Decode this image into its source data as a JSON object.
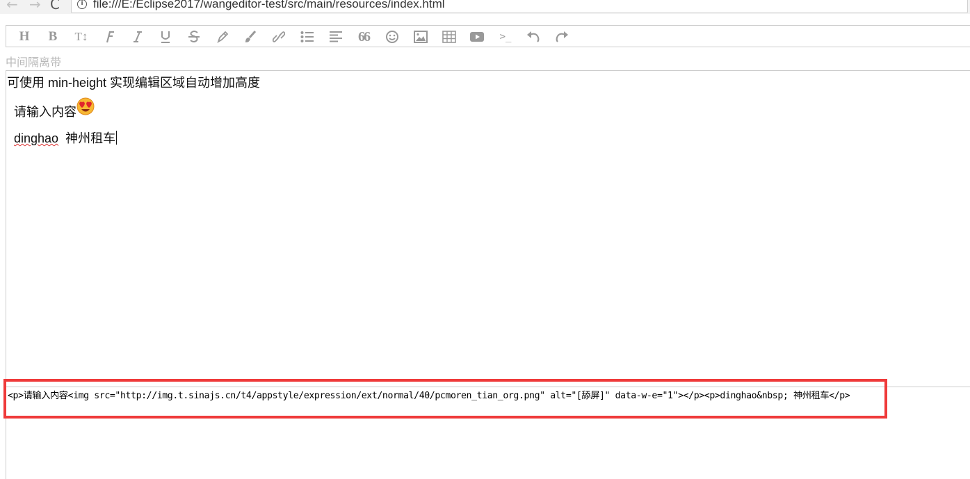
{
  "browser": {
    "back_glyph": "←",
    "forward_glyph": "→",
    "reload_glyph": "C",
    "info_glyph": "i",
    "url": "file:///E:/Eclipse2017/wangeditor-test/src/main/resources/index.html"
  },
  "toolbar": {
    "head_label": "H",
    "bold_label": "B",
    "fontsize_label": "T↕",
    "quote_label": "66",
    "code_label": ">_",
    "items": [
      {
        "icon": "heading-icon"
      },
      {
        "icon": "bold-icon"
      },
      {
        "icon": "font-size-icon"
      },
      {
        "icon": "font-name-icon"
      },
      {
        "icon": "italic-icon"
      },
      {
        "icon": "underline-icon"
      },
      {
        "icon": "strikethrough-icon"
      },
      {
        "icon": "text-color-icon"
      },
      {
        "icon": "background-color-icon"
      },
      {
        "icon": "link-icon"
      },
      {
        "icon": "list-icon"
      },
      {
        "icon": "justify-icon"
      },
      {
        "icon": "quote-icon"
      },
      {
        "icon": "emoticon-icon"
      },
      {
        "icon": "image-icon"
      },
      {
        "icon": "table-icon"
      },
      {
        "icon": "video-icon"
      },
      {
        "icon": "code-icon"
      },
      {
        "icon": "undo-icon"
      },
      {
        "icon": "redo-icon"
      }
    ],
    "icon_color": "#999999"
  },
  "divider": {
    "text": "中间隔离带"
  },
  "editor": {
    "hint": "可使用 min-height 实现编辑区域自动增加高度",
    "line1": "请输入内容",
    "line2_word": "dinghao",
    "line2_rest": "  神州租车",
    "emoji_icon": "heart-eyes-emoji-icon"
  },
  "output": {
    "html": "<p>请输入内容<img src=\"http://img.t.sinajs.cn/t4/appstyle/expression/ext/normal/40/pcmoren_tian_org.png\" alt=\"[舔屏]\" data-w-e=\"1\"></p><p>dinghao&nbsp; 神州租车</p>"
  },
  "colors": {
    "highlight": "#ef3a3a",
    "border": "#cccccc",
    "divider_text": "#b8b8b8"
  }
}
